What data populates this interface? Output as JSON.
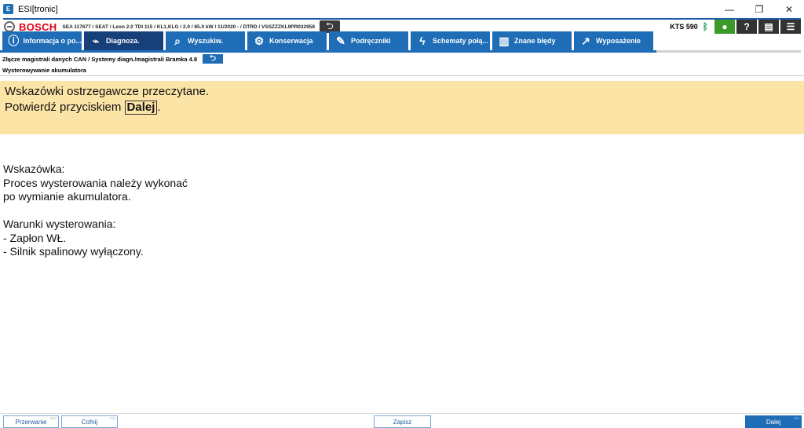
{
  "window": {
    "title": "ESI[tronic]",
    "icon": "esi-icon",
    "controls": [
      "—",
      "❐",
      "✕"
    ]
  },
  "header": {
    "brand": "BOSCH",
    "vehicle_info": "SEA 117677 / SEAT / Leon 2.0 TDI 115 / KL1,KLG / 2.0 / 85.0 kW / 11/2020 - / DTRD / VSSZZZKL9PR032958",
    "device": "KTS 590",
    "bluetooth_icon": "bluetooth-icon",
    "buttons": [
      "user-icon",
      "help-icon",
      "print-icon",
      "menu-icon"
    ]
  },
  "tabs": [
    {
      "label": "Informacja o po...",
      "icon": "info-icon"
    },
    {
      "label": "Diagnoza.",
      "icon": "diagnosis-icon"
    },
    {
      "label": "Wyszukiw.",
      "icon": "search-icon"
    },
    {
      "label": "Konserwacja",
      "icon": "gears-icon"
    },
    {
      "label": "Podręczniki",
      "icon": "wrench-icon"
    },
    {
      "label": "Schematy połą...",
      "icon": "lightning-icon"
    },
    {
      "label": "Znane błędy",
      "icon": "book-icon"
    },
    {
      "label": "Wyposażenie",
      "icon": "external-link-icon"
    }
  ],
  "active_tab": "Diagnoza.",
  "breadcrumb": "Złącze magistrali danych CAN / Systemy diagn./magistrali Bramka 4.8",
  "subtitle": "Wysterowywanie akumulatora",
  "notice": {
    "line1": "Wskazówki ostrzegawcze przeczytane.",
    "line2_prefix": "Potwierdź przyciskiem ",
    "line2_button": "Dalej",
    "line2_suffix": "."
  },
  "body": {
    "hint_title": "Wskazówka:",
    "hint_line1": "Proces wysterowania należy wykonać",
    "hint_line2": "po wymianie akumulatora.",
    "cond_title": "Warunki wysterowania:",
    "cond_line1": "- Zapłon WŁ.",
    "cond_line2": "- Silnik spalinowy wyłączony."
  },
  "footer": {
    "cancel": "Przerwanie",
    "cancel_key": "ESC",
    "back": "Cofnij",
    "back_key": "F11",
    "save": "Zapisz",
    "next": "Dalej",
    "next_key": "F12"
  },
  "colors": {
    "tab_blue": "#1e6db6",
    "tab_active": "#173f7a",
    "notice_bg": "#fce3a6",
    "bosch_red": "#e20015"
  }
}
